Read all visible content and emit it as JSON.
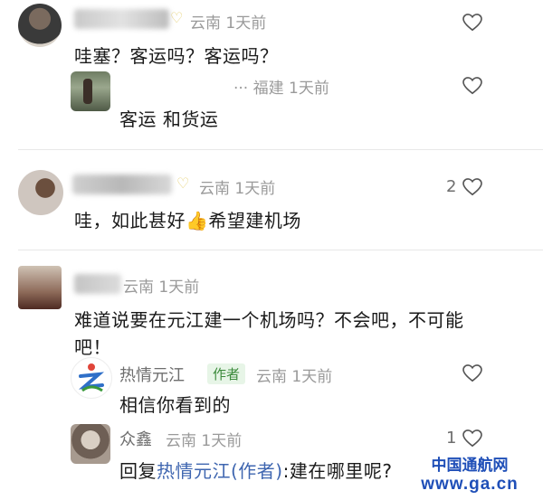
{
  "comments": [
    {
      "meta": "云南 1天前",
      "text": "哇塞？客运吗？客运吗？",
      "reply": {
        "meta": "··· 福建 1天前",
        "text": "客运 和货运"
      }
    },
    {
      "meta": "云南 1天前",
      "like_count": "2",
      "text_before": "哇，如此甚好",
      "emoji": "👍",
      "text_after": "希望建机场"
    },
    {
      "meta": "云南 1天前",
      "text_line1": "难道说要在元江建一个机场吗？不会吧，不可能",
      "text_line2": "吧！",
      "replies": [
        {
          "name": "热情元江",
          "badge": "作者",
          "meta": "云南 1天前",
          "text": "相信你看到的"
        },
        {
          "name": "众鑫",
          "meta": "云南 1天前",
          "like_count": "1",
          "text_prefix": "回复",
          "text_link": "热情元江(作者)",
          "text_suffix": ":建在哪里呢?"
        }
      ]
    }
  ],
  "watermark": {
    "line1": "中国通航网",
    "line2": "www.ga.cn"
  },
  "colors": {
    "author_badge": "#3b8a3b",
    "reply_link": "#3f66b0",
    "watermark": "#1f4fb8"
  }
}
